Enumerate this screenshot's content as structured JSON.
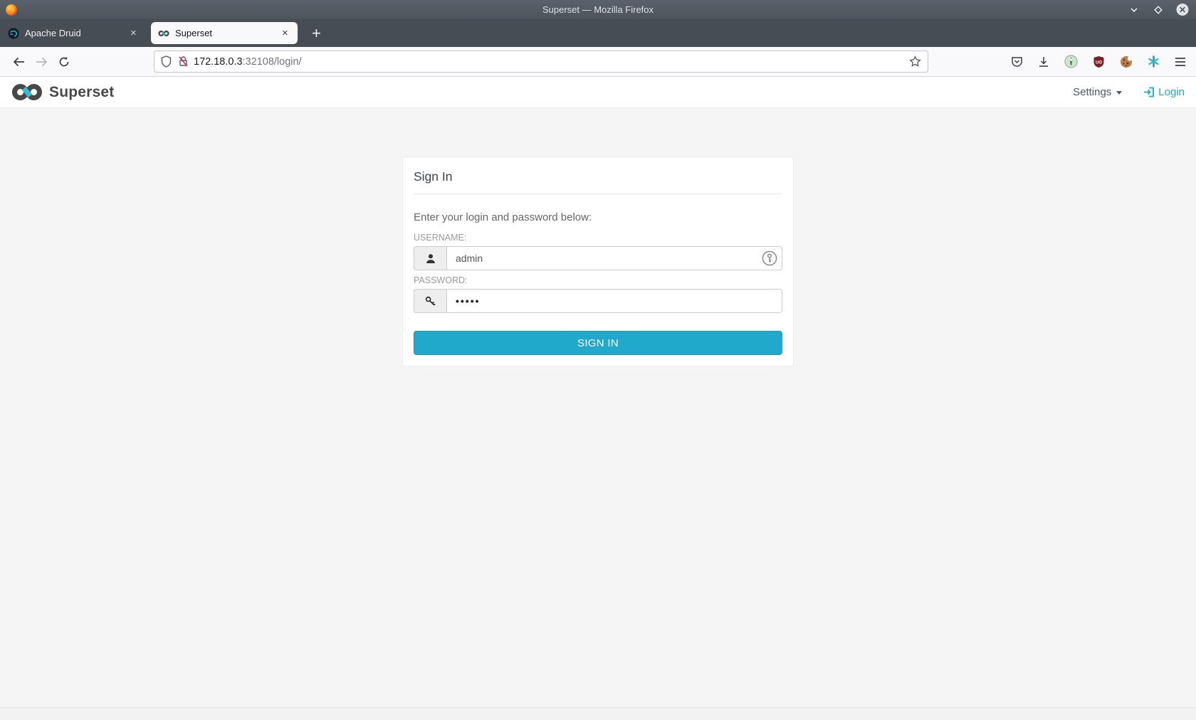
{
  "window": {
    "title": "Superset — Mozilla Firefox"
  },
  "browser": {
    "tabs": [
      {
        "title": "Apache Druid",
        "favicon": "druid-logo"
      },
      {
        "title": "Superset",
        "favicon": "superset-logo"
      }
    ],
    "close_glyph": "✕",
    "new_tab_glyph": "+",
    "url": {
      "host": "172.18.0.3",
      "rest": ":32108/login/"
    },
    "toolbar_icons": [
      "shield",
      "lock-insecure",
      "bookmark-star",
      "pocket",
      "download",
      "extension-green",
      "extension-shield",
      "extension-cookie",
      "extension-asterisk",
      "menu"
    ]
  },
  "navbar": {
    "brand": "Superset",
    "settings_label": "Settings",
    "login_label": "Login"
  },
  "login_card": {
    "title": "Sign In",
    "instruction": "Enter your login and password below:",
    "username_label": "USERNAME:",
    "username_value": "admin",
    "password_label": "PASSWORD:",
    "password_value": "•••••",
    "submit_label": "SIGN IN"
  },
  "colors": {
    "primary_accent": "#20a7c9",
    "signin_button": "#21a9cb",
    "titlebar": "#525960",
    "tabstrip": "#474d55",
    "brand_dark": "#484848",
    "brand_teal": "#36bcd3"
  }
}
